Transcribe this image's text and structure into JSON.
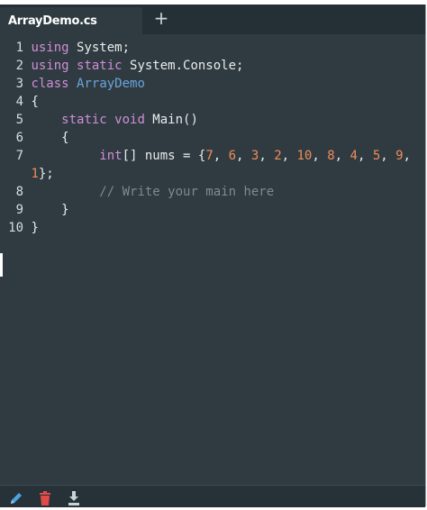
{
  "tab": {
    "filename": "ArrayDemo.cs",
    "add_label": "+"
  },
  "editor": {
    "lines": [
      {
        "n": "1",
        "tokens": [
          [
            "kw",
            "using"
          ],
          [
            "pl",
            " System;"
          ]
        ]
      },
      {
        "n": "2",
        "tokens": [
          [
            "kw",
            "using static"
          ],
          [
            "pl",
            " System.Console;"
          ]
        ]
      },
      {
        "n": "3",
        "tokens": [
          [
            "kw",
            "class"
          ],
          [
            "pl",
            " "
          ],
          [
            "ty",
            "ArrayDemo"
          ]
        ]
      },
      {
        "n": "4",
        "tokens": [
          [
            "pl",
            "{"
          ]
        ]
      },
      {
        "n": "5",
        "tokens": [
          [
            "pl",
            "    "
          ],
          [
            "kw",
            "static void"
          ],
          [
            "pl",
            " Main()"
          ]
        ]
      },
      {
        "n": "6",
        "tokens": [
          [
            "pl",
            "    {"
          ]
        ]
      },
      {
        "n": "7",
        "tokens": [
          [
            "pl",
            "         "
          ],
          [
            "kw",
            "int"
          ],
          [
            "pl",
            "[] nums = {"
          ],
          [
            "num",
            "7"
          ],
          [
            "pl",
            ", "
          ],
          [
            "num",
            "6"
          ],
          [
            "pl",
            ", "
          ],
          [
            "num",
            "3"
          ],
          [
            "pl",
            ", "
          ],
          [
            "num",
            "2"
          ],
          [
            "pl",
            ", "
          ],
          [
            "num",
            "10"
          ],
          [
            "pl",
            ", "
          ],
          [
            "num",
            "8"
          ],
          [
            "pl",
            ", "
          ],
          [
            "num",
            "4"
          ],
          [
            "pl",
            ", "
          ],
          [
            "num",
            "5"
          ],
          [
            "pl",
            ", "
          ],
          [
            "num",
            "9"
          ],
          [
            "pl",
            ","
          ]
        ]
      },
      {
        "n": "",
        "tokens": [
          [
            "num",
            "1"
          ],
          [
            "pl",
            "};"
          ]
        ]
      },
      {
        "n": "8",
        "tokens": [
          [
            "pl",
            "         "
          ],
          [
            "cm",
            "// Write your main here"
          ]
        ]
      },
      {
        "n": "9",
        "tokens": [
          [
            "pl",
            "    }"
          ]
        ]
      },
      {
        "n": "10",
        "tokens": [
          [
            "pl",
            "}"
          ]
        ]
      }
    ]
  },
  "toolbar": {
    "icons": [
      "pencil-icon",
      "trash-icon",
      "download-icon"
    ]
  },
  "colors": {
    "keyword": "#d08ed8",
    "type": "#6aa4dc",
    "number": "#f08c5a",
    "comment": "#7d8a90",
    "background": "#2f3b40"
  }
}
